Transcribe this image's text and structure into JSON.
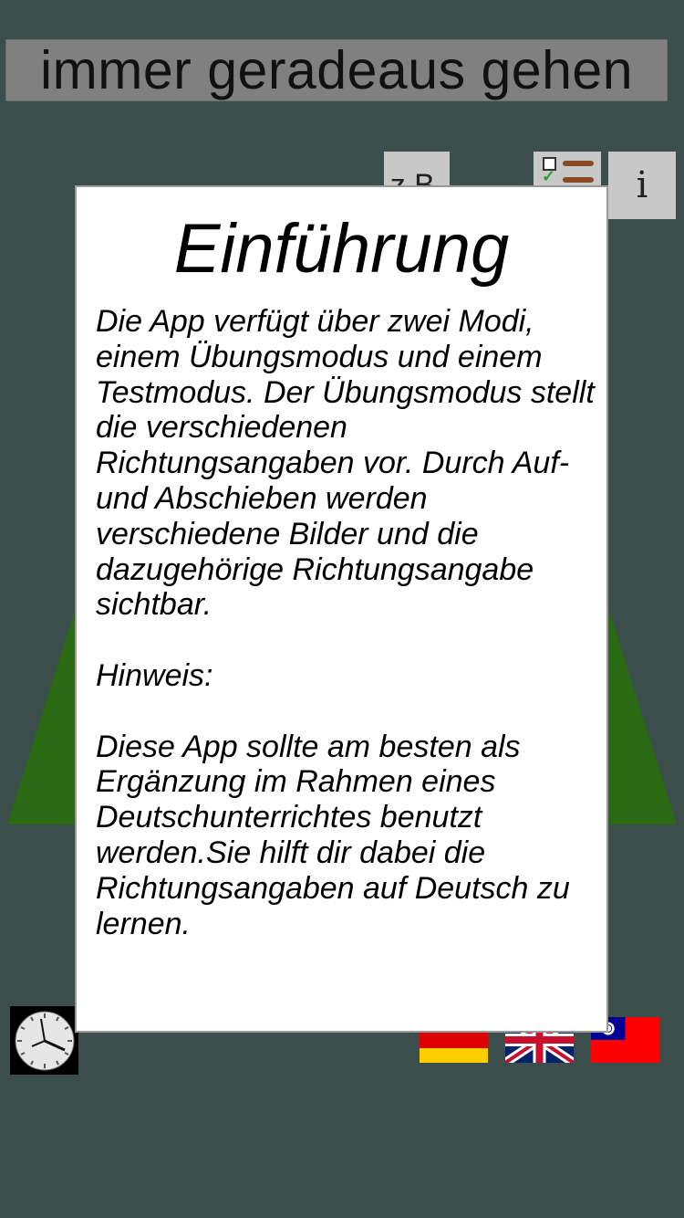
{
  "header": {
    "phrase": "immer geradeaus gehen"
  },
  "toolbar": {
    "example_label": "z.B.",
    "mode_icon": "checklist-icon",
    "info_label": "i"
  },
  "dialog": {
    "title": "Einführung",
    "paragraph1": "Die App verfügt über zwei Modi, einem Übungsmodus und einem Testmodus. Der Übungsmodus stellt die verschiedenen Richtungsangaben vor. Durch Auf- und Abschieben werden verschiedene Bilder und die dazugehörige Richtungsangabe sichtbar.",
    "hint_label": "Hinweis:",
    "paragraph2": "Diese App sollte am besten als Ergänzung im Rahmen eines Deutschunterrichtes benutzt werden.Sie hilft dir dabei die Richtungsangaben auf Deutsch zu lernen."
  },
  "bottom": {
    "clock_icon": "clock-icon",
    "languages": [
      "german-flag-icon",
      "uk-flag-icon",
      "taiwan-flag-icon"
    ]
  },
  "colors": {
    "background": "#3c4e4b",
    "road_green": "#2a6a12",
    "header_bg": "#808080",
    "button_bg": "#c8c8c8"
  }
}
